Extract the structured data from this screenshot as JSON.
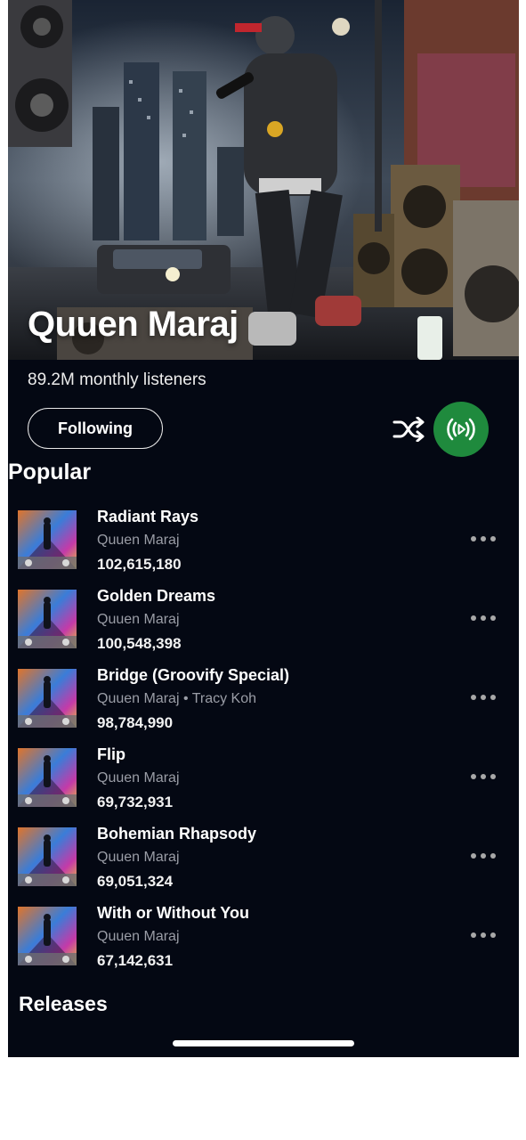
{
  "artist": {
    "name": "Quuen Maraj",
    "monthly_listeners": "89.2M monthly listeners"
  },
  "actions": {
    "follow_label": "Following",
    "shuffle_icon": "shuffle-icon",
    "play_icon": "play-broadcast-icon"
  },
  "sections": {
    "popular": "Popular",
    "releases": "Releases"
  },
  "tracks": [
    {
      "title": "Radiant Rays",
      "artist": "Quuen Maraj",
      "plays": "102,615,180"
    },
    {
      "title": "Golden Dreams",
      "artist": "Quuen Maraj",
      "plays": "100,548,398"
    },
    {
      "title": "Bridge (Groovify Special)",
      "artist": "Quuen Maraj • Tracy Koh",
      "plays": "98,784,990"
    },
    {
      "title": "Flip",
      "artist": "Quuen Maraj",
      "plays": "69,732,931"
    },
    {
      "title": "Bohemian Rhapsody",
      "artist": "Quuen Maraj",
      "plays": "69,051,324"
    },
    {
      "title": "With or Without You",
      "artist": "Quuen Maraj",
      "plays": "67,142,631"
    }
  ],
  "colors": {
    "background": "#040813",
    "accent_green": "#1f8a3d",
    "secondary_text": "#9a9da6"
  }
}
